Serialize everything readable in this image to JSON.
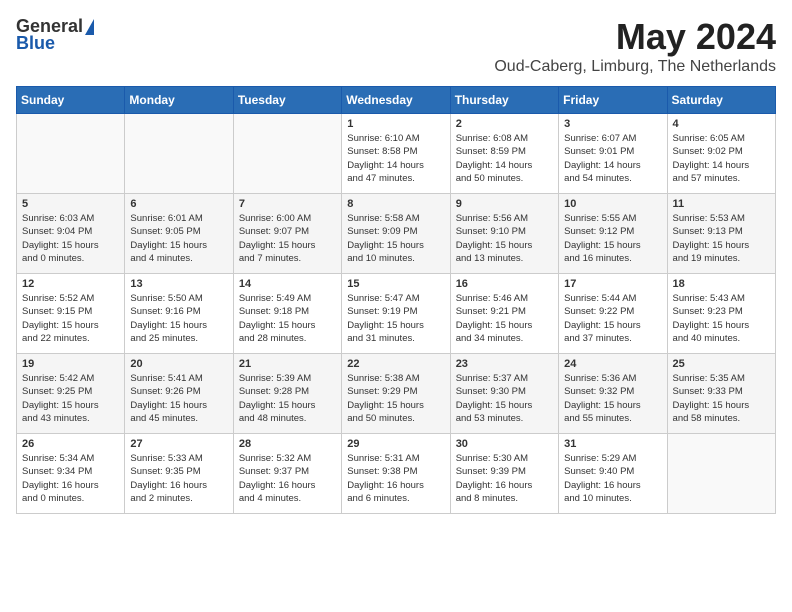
{
  "header": {
    "logo_general": "General",
    "logo_blue": "Blue",
    "month": "May 2024",
    "location": "Oud-Caberg, Limburg, The Netherlands"
  },
  "days_of_week": [
    "Sunday",
    "Monday",
    "Tuesday",
    "Wednesday",
    "Thursday",
    "Friday",
    "Saturday"
  ],
  "weeks": [
    [
      {
        "day": "",
        "content": ""
      },
      {
        "day": "",
        "content": ""
      },
      {
        "day": "",
        "content": ""
      },
      {
        "day": "1",
        "content": "Sunrise: 6:10 AM\nSunset: 8:58 PM\nDaylight: 14 hours\nand 47 minutes."
      },
      {
        "day": "2",
        "content": "Sunrise: 6:08 AM\nSunset: 8:59 PM\nDaylight: 14 hours\nand 50 minutes."
      },
      {
        "day": "3",
        "content": "Sunrise: 6:07 AM\nSunset: 9:01 PM\nDaylight: 14 hours\nand 54 minutes."
      },
      {
        "day": "4",
        "content": "Sunrise: 6:05 AM\nSunset: 9:02 PM\nDaylight: 14 hours\nand 57 minutes."
      }
    ],
    [
      {
        "day": "5",
        "content": "Sunrise: 6:03 AM\nSunset: 9:04 PM\nDaylight: 15 hours\nand 0 minutes."
      },
      {
        "day": "6",
        "content": "Sunrise: 6:01 AM\nSunset: 9:05 PM\nDaylight: 15 hours\nand 4 minutes."
      },
      {
        "day": "7",
        "content": "Sunrise: 6:00 AM\nSunset: 9:07 PM\nDaylight: 15 hours\nand 7 minutes."
      },
      {
        "day": "8",
        "content": "Sunrise: 5:58 AM\nSunset: 9:09 PM\nDaylight: 15 hours\nand 10 minutes."
      },
      {
        "day": "9",
        "content": "Sunrise: 5:56 AM\nSunset: 9:10 PM\nDaylight: 15 hours\nand 13 minutes."
      },
      {
        "day": "10",
        "content": "Sunrise: 5:55 AM\nSunset: 9:12 PM\nDaylight: 15 hours\nand 16 minutes."
      },
      {
        "day": "11",
        "content": "Sunrise: 5:53 AM\nSunset: 9:13 PM\nDaylight: 15 hours\nand 19 minutes."
      }
    ],
    [
      {
        "day": "12",
        "content": "Sunrise: 5:52 AM\nSunset: 9:15 PM\nDaylight: 15 hours\nand 22 minutes."
      },
      {
        "day": "13",
        "content": "Sunrise: 5:50 AM\nSunset: 9:16 PM\nDaylight: 15 hours\nand 25 minutes."
      },
      {
        "day": "14",
        "content": "Sunrise: 5:49 AM\nSunset: 9:18 PM\nDaylight: 15 hours\nand 28 minutes."
      },
      {
        "day": "15",
        "content": "Sunrise: 5:47 AM\nSunset: 9:19 PM\nDaylight: 15 hours\nand 31 minutes."
      },
      {
        "day": "16",
        "content": "Sunrise: 5:46 AM\nSunset: 9:21 PM\nDaylight: 15 hours\nand 34 minutes."
      },
      {
        "day": "17",
        "content": "Sunrise: 5:44 AM\nSunset: 9:22 PM\nDaylight: 15 hours\nand 37 minutes."
      },
      {
        "day": "18",
        "content": "Sunrise: 5:43 AM\nSunset: 9:23 PM\nDaylight: 15 hours\nand 40 minutes."
      }
    ],
    [
      {
        "day": "19",
        "content": "Sunrise: 5:42 AM\nSunset: 9:25 PM\nDaylight: 15 hours\nand 43 minutes."
      },
      {
        "day": "20",
        "content": "Sunrise: 5:41 AM\nSunset: 9:26 PM\nDaylight: 15 hours\nand 45 minutes."
      },
      {
        "day": "21",
        "content": "Sunrise: 5:39 AM\nSunset: 9:28 PM\nDaylight: 15 hours\nand 48 minutes."
      },
      {
        "day": "22",
        "content": "Sunrise: 5:38 AM\nSunset: 9:29 PM\nDaylight: 15 hours\nand 50 minutes."
      },
      {
        "day": "23",
        "content": "Sunrise: 5:37 AM\nSunset: 9:30 PM\nDaylight: 15 hours\nand 53 minutes."
      },
      {
        "day": "24",
        "content": "Sunrise: 5:36 AM\nSunset: 9:32 PM\nDaylight: 15 hours\nand 55 minutes."
      },
      {
        "day": "25",
        "content": "Sunrise: 5:35 AM\nSunset: 9:33 PM\nDaylight: 15 hours\nand 58 minutes."
      }
    ],
    [
      {
        "day": "26",
        "content": "Sunrise: 5:34 AM\nSunset: 9:34 PM\nDaylight: 16 hours\nand 0 minutes."
      },
      {
        "day": "27",
        "content": "Sunrise: 5:33 AM\nSunset: 9:35 PM\nDaylight: 16 hours\nand 2 minutes."
      },
      {
        "day": "28",
        "content": "Sunrise: 5:32 AM\nSunset: 9:37 PM\nDaylight: 16 hours\nand 4 minutes."
      },
      {
        "day": "29",
        "content": "Sunrise: 5:31 AM\nSunset: 9:38 PM\nDaylight: 16 hours\nand 6 minutes."
      },
      {
        "day": "30",
        "content": "Sunrise: 5:30 AM\nSunset: 9:39 PM\nDaylight: 16 hours\nand 8 minutes."
      },
      {
        "day": "31",
        "content": "Sunrise: 5:29 AM\nSunset: 9:40 PM\nDaylight: 16 hours\nand 10 minutes."
      },
      {
        "day": "",
        "content": ""
      }
    ]
  ]
}
